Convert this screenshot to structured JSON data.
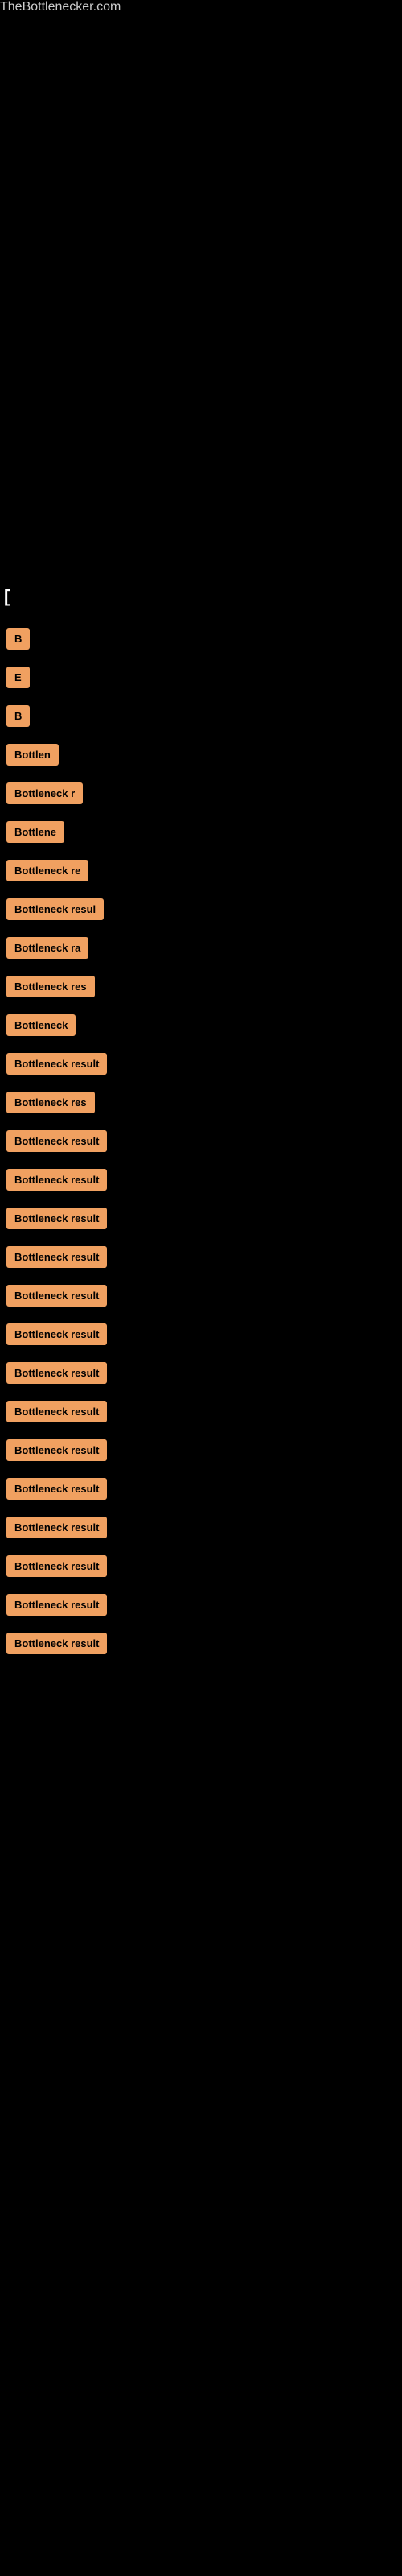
{
  "site": {
    "title": "TheBottlenecker.com"
  },
  "header": {
    "bracket": "["
  },
  "items": [
    {
      "id": 1,
      "label": "B",
      "width_class": "w-20"
    },
    {
      "id": 2,
      "label": "E",
      "width_class": "w-20"
    },
    {
      "id": 3,
      "label": "B",
      "width_class": "w-20"
    },
    {
      "id": 4,
      "label": "Bottlen",
      "width_class": "w-55"
    },
    {
      "id": 5,
      "label": "Bottleneck r",
      "width_class": "w-80"
    },
    {
      "id": 6,
      "label": "Bottlene",
      "width_class": "w-55"
    },
    {
      "id": 7,
      "label": "Bottleneck re",
      "width_class": "w-90"
    },
    {
      "id": 8,
      "label": "Bottleneck resul",
      "width_class": "w-110"
    },
    {
      "id": 9,
      "label": "Bottleneck ra",
      "width_class": "w-80"
    },
    {
      "id": 10,
      "label": "Bottleneck res",
      "width_class": "w-100"
    },
    {
      "id": 11,
      "label": "Bottleneck",
      "width_class": "w-80"
    },
    {
      "id": 12,
      "label": "Bottleneck result",
      "width_class": "w-120"
    },
    {
      "id": 13,
      "label": "Bottleneck res",
      "width_class": "w-100"
    },
    {
      "id": 14,
      "label": "Bottleneck result",
      "width_class": "w-130"
    },
    {
      "id": 15,
      "label": "Bottleneck result",
      "width_class": "w-130"
    },
    {
      "id": 16,
      "label": "Bottleneck result",
      "width_class": "w-140"
    },
    {
      "id": 17,
      "label": "Bottleneck result",
      "width_class": "w-140"
    },
    {
      "id": 18,
      "label": "Bottleneck result",
      "width_class": "w-150"
    },
    {
      "id": 19,
      "label": "Bottleneck result",
      "width_class": "w-150"
    },
    {
      "id": 20,
      "label": "Bottleneck result",
      "width_class": "w-150"
    },
    {
      "id": 21,
      "label": "Bottleneck result",
      "width_class": "w-150"
    },
    {
      "id": 22,
      "label": "Bottleneck result",
      "width_class": "w-160"
    },
    {
      "id": 23,
      "label": "Bottleneck result",
      "width_class": "w-160"
    },
    {
      "id": 24,
      "label": "Bottleneck result",
      "width_class": "w-160"
    },
    {
      "id": 25,
      "label": "Bottleneck result",
      "width_class": "w-160"
    },
    {
      "id": 26,
      "label": "Bottleneck result",
      "width_class": "w-160"
    },
    {
      "id": 27,
      "label": "Bottleneck result",
      "width_class": "w-160"
    }
  ]
}
